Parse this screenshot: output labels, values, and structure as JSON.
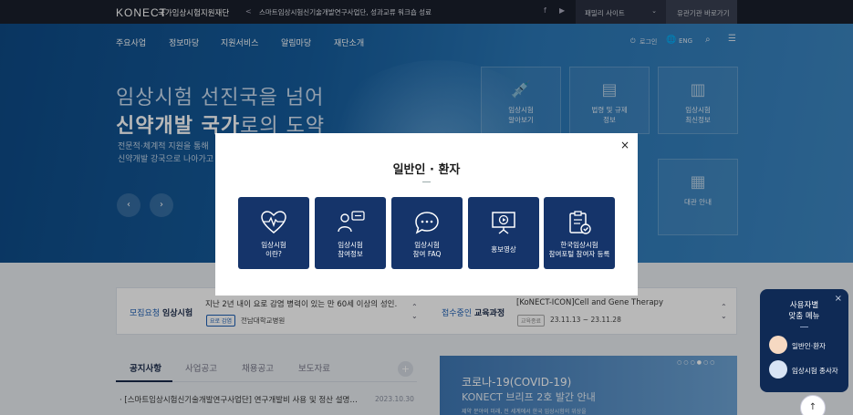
{
  "topbar": {
    "logo": "KONECT",
    "org_name": "국가임상시험지원재단",
    "news_arrow": "<",
    "news_text": "스마트임상시험신기술개발연구사업단, 성과교류 워크숍 성료",
    "family_site": "패밀리 사이트",
    "agency_link": "유관기관 바로가기"
  },
  "gnb": {
    "items": [
      "주요사업",
      "정보마당",
      "지원서비스",
      "알림마당",
      "재단소개"
    ],
    "login": "로그인",
    "lang": "ENG"
  },
  "hero": {
    "line1": "임상시험 선진국을 넘어",
    "line2_bold": "신약개발 국가",
    "line2_rest": "로의 도약",
    "sub1": "전문적·체계적 지원을 통해",
    "sub2": "신약개발 강국으로 나아가고",
    "prev": "‹",
    "next": "›",
    "quick": [
      {
        "label1": "임상시험",
        "label2": "알아보기"
      },
      {
        "label1": "법령 및 규제",
        "label2": "정보"
      },
      {
        "label1": "임상시험",
        "label2": "최신정보"
      },
      {
        "label1": "대관 안내",
        "label2": ""
      }
    ]
  },
  "modal": {
    "title": "일반인 · 환자",
    "close": "×",
    "cards": [
      {
        "line1": "임상시험",
        "line2": "이란?"
      },
      {
        "line1": "임상시험",
        "line2": "참여정보"
      },
      {
        "line1": "임상시험",
        "line2": "참여 FAQ"
      },
      {
        "line1": "홍보영상",
        "line2": ""
      },
      {
        "line1": "한국임상시험",
        "line2": "참여포털 참여자 등록"
      }
    ]
  },
  "info": {
    "left_title_accent": "모집요청",
    "left_title_rest": "임상시험",
    "left_text": "지난 2년 내이 요로 감염 병력이 있는 만 60세 이상의 성인…",
    "left_chip": "요로 감염",
    "left_sub": "전남대학교병원",
    "right_title_accent": "접수중인",
    "right_title_rest": "교육과정",
    "right_text": "[KoNECT-ICON]Cell and Gene Therapy",
    "right_chip": "교육종료",
    "right_sub": "23.11.13 ~ 23.11.28"
  },
  "board": {
    "tabs": [
      "공지사항",
      "사업공고",
      "채용공고",
      "보도자료"
    ],
    "plus": "+",
    "notice_text": "· [스마트임상시험신기술개발연구사업단] 연구개발비 사용 및 정산 설명…",
    "notice_date": "2023.10.30"
  },
  "banner": {
    "title": "코로나-19(COVID-19)",
    "subtitle": "KONECT 브리프 2호 발간 안내",
    "small": "제약 분야의 미래, 전 세계에서 한국 임상시험의 위상을"
  },
  "float_menu": {
    "title1": "사용자별",
    "title2": "맞춤 메뉴",
    "close": "×",
    "items": [
      "일반인·환자",
      "임상시험 종사자"
    ]
  },
  "top_button": "↑"
}
